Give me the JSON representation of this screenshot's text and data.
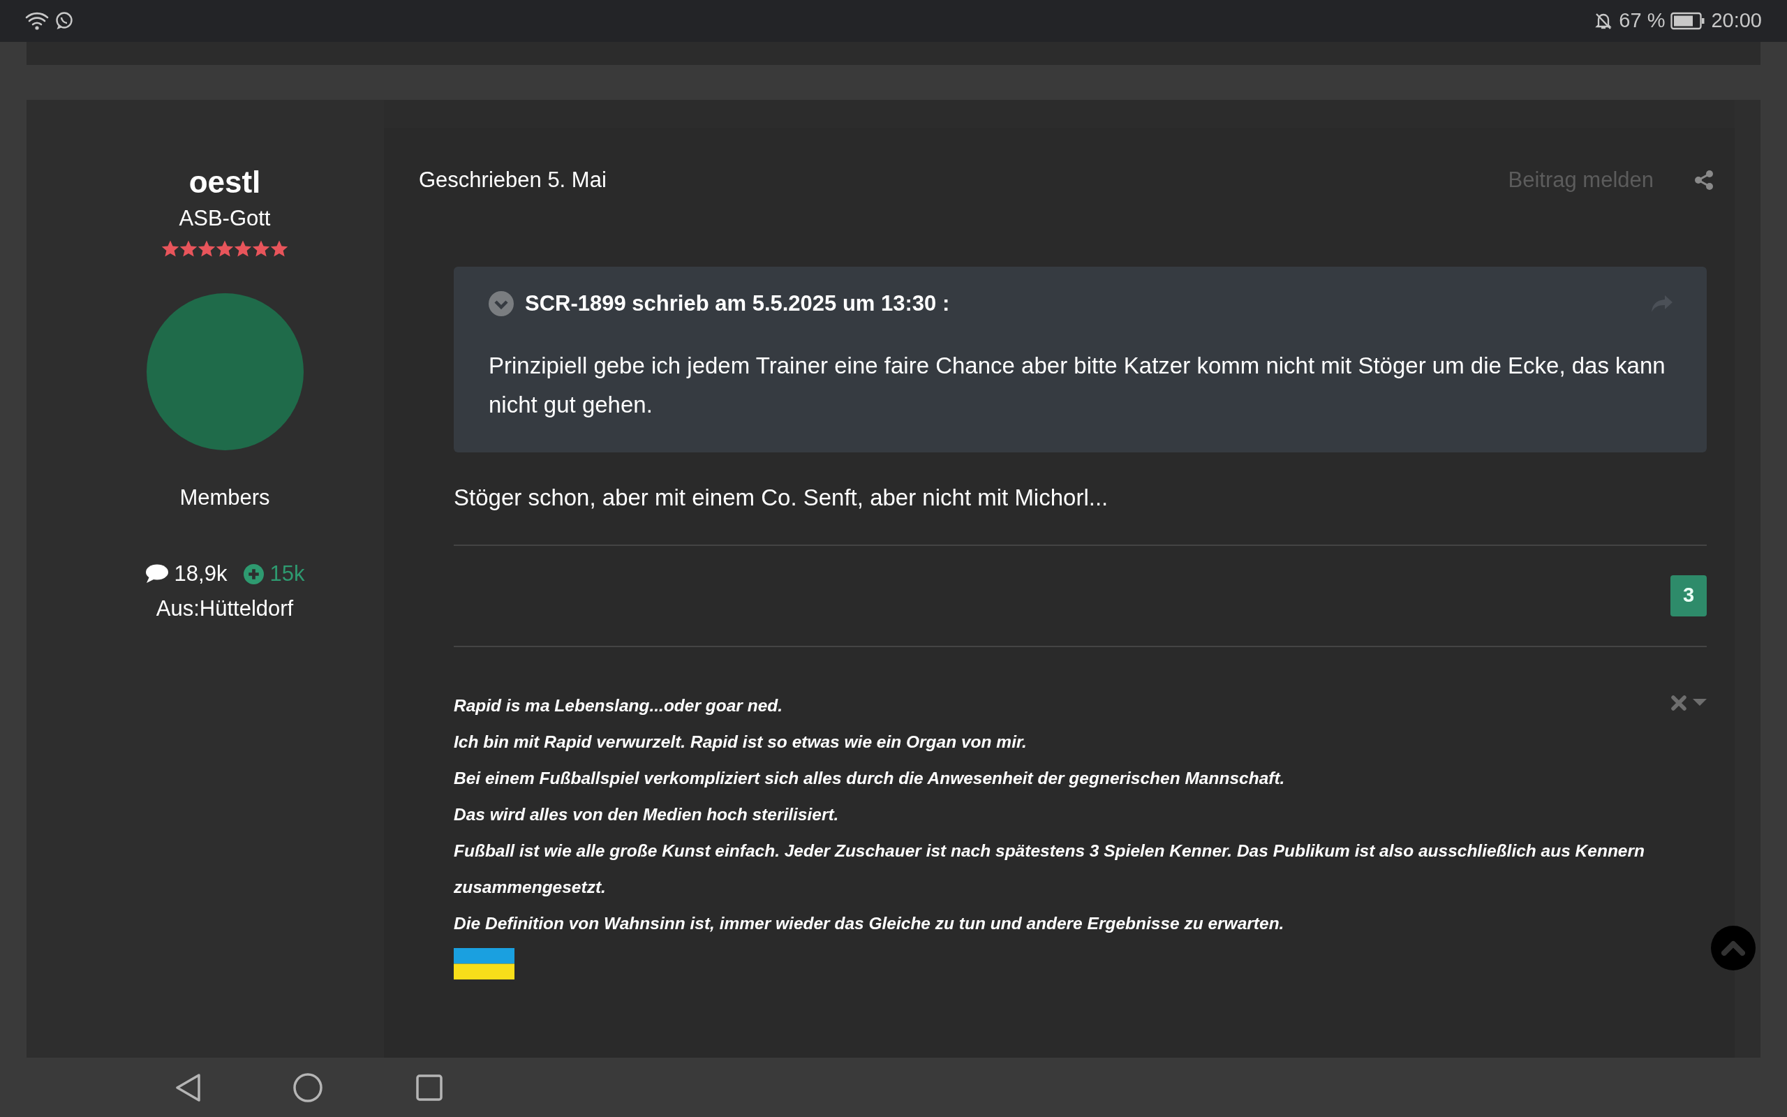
{
  "status_bar": {
    "battery": "67 %",
    "time": "20:00"
  },
  "author": {
    "name": "oestl",
    "rank": "ASB-Gott",
    "stars": 7,
    "group": "Members",
    "posts": "18,9k",
    "reputation": "15k",
    "location": "Aus:Hütteldorf"
  },
  "post": {
    "date": "Geschrieben 5. Mai",
    "report": "Beitrag melden",
    "quote": {
      "header": "SCR-1899 schrieb am 5.5.2025 um 13:30 :",
      "text": "Prinzipiell gebe ich jedem Trainer eine faire Chance aber bitte Katzer komm nicht mit Stöger um die Ecke, das kann nicht gut gehen."
    },
    "text": "Stöger schon, aber mit einem Co. Senft, aber nicht mit Michorl...",
    "reactions": "3",
    "signature": [
      "Rapid is ma Lebenslang...oder goar ned.",
      "Ich bin mit Rapid verwurzelt. Rapid ist so etwas wie ein Organ von mir.",
      "Bei einem Fußballspiel verkompliziert sich alles durch die Anwesenheit der gegnerischen Mannschaft.",
      "Das wird alles von den Medien hoch sterilisiert.",
      "Fußball ist wie alle große Kunst einfach. Jeder Zuschauer ist nach spätestens 3 Spielen Kenner. Das Publikum ist also ausschließlich aus Kennern zusammengesetzt.",
      "Die Definition von Wahnsinn ist, immer wieder das Gleiche zu tun und andere Ergebnisse zu erwarten."
    ]
  }
}
